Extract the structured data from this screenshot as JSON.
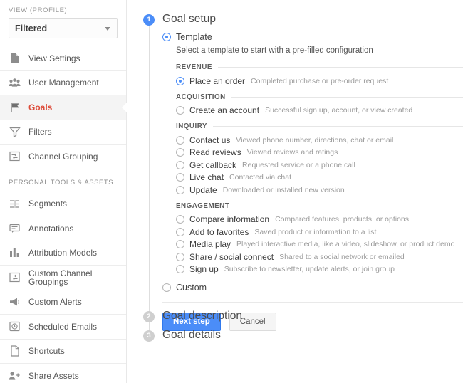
{
  "sidebar": {
    "view_label": "VIEW (PROFILE)",
    "view_value": "Filtered",
    "items": [
      {
        "label": "View Settings",
        "icon": "document-icon",
        "active": false
      },
      {
        "label": "User Management",
        "icon": "people-icon",
        "active": false
      },
      {
        "label": "Goals",
        "icon": "flag-icon",
        "active": true
      },
      {
        "label": "Filters",
        "icon": "funnel-icon",
        "active": false
      },
      {
        "label": "Channel Grouping",
        "icon": "channel-grouping-icon",
        "active": false
      }
    ],
    "personal_section_label": "PERSONAL TOOLS & ASSETS",
    "personal_items": [
      {
        "label": "Segments",
        "icon": "segments-icon"
      },
      {
        "label": "Annotations",
        "icon": "annotation-icon"
      },
      {
        "label": "Attribution Models",
        "icon": "bar-chart-icon"
      },
      {
        "label": "Custom Channel Groupings",
        "icon": "channel-grouping-icon"
      },
      {
        "label": "Custom Alerts",
        "icon": "megaphone-icon"
      },
      {
        "label": "Scheduled Emails",
        "icon": "clock-icon"
      },
      {
        "label": "Shortcuts",
        "icon": "page-icon"
      },
      {
        "label": "Share Assets",
        "icon": "add-person-icon"
      }
    ]
  },
  "main": {
    "steps": [
      {
        "number": "1",
        "title": "Goal setup",
        "state": "active"
      },
      {
        "number": "2",
        "title": "Goal description",
        "state": "inactive"
      },
      {
        "number": "3",
        "title": "Goal details",
        "state": "inactive"
      }
    ],
    "mode_template_label": "Template",
    "mode_custom_label": "Custom",
    "helper_text": "Select a template to start with a pre-filled configuration",
    "groups": [
      {
        "title": "REVENUE",
        "options": [
          {
            "name": "Place an order",
            "desc": "Completed purchase or pre-order request",
            "selected": true
          }
        ]
      },
      {
        "title": "ACQUISITION",
        "options": [
          {
            "name": "Create an account",
            "desc": "Successful sign up, account, or view created",
            "selected": false
          }
        ]
      },
      {
        "title": "INQUIRY",
        "options": [
          {
            "name": "Contact us",
            "desc": "Viewed phone number, directions, chat or email",
            "selected": false
          },
          {
            "name": "Read reviews",
            "desc": "Viewed reviews and ratings",
            "selected": false
          },
          {
            "name": "Get callback",
            "desc": "Requested service or a phone call",
            "selected": false
          },
          {
            "name": "Live chat",
            "desc": "Contacted via chat",
            "selected": false
          },
          {
            "name": "Update",
            "desc": "Downloaded or installed new version",
            "selected": false
          }
        ]
      },
      {
        "title": "ENGAGEMENT",
        "options": [
          {
            "name": "Compare information",
            "desc": "Compared features, products, or options",
            "selected": false
          },
          {
            "name": "Add to favorites",
            "desc": "Saved product or information to a list",
            "selected": false
          },
          {
            "name": "Media play",
            "desc": "Played interactive media, like a video, slideshow, or product demo",
            "selected": false
          },
          {
            "name": "Share / social connect",
            "desc": "Shared to a social network or emailed",
            "selected": false
          },
          {
            "name": "Sign up",
            "desc": "Subscribe to newsletter, update alerts, or join group",
            "selected": false
          }
        ]
      }
    ],
    "next_button_label": "Next step",
    "cancel_button_label": "Cancel"
  },
  "colors": {
    "accent_blue": "#4b8df8",
    "active_red": "#dd4b39",
    "muted_gray": "#cfcfcf"
  }
}
